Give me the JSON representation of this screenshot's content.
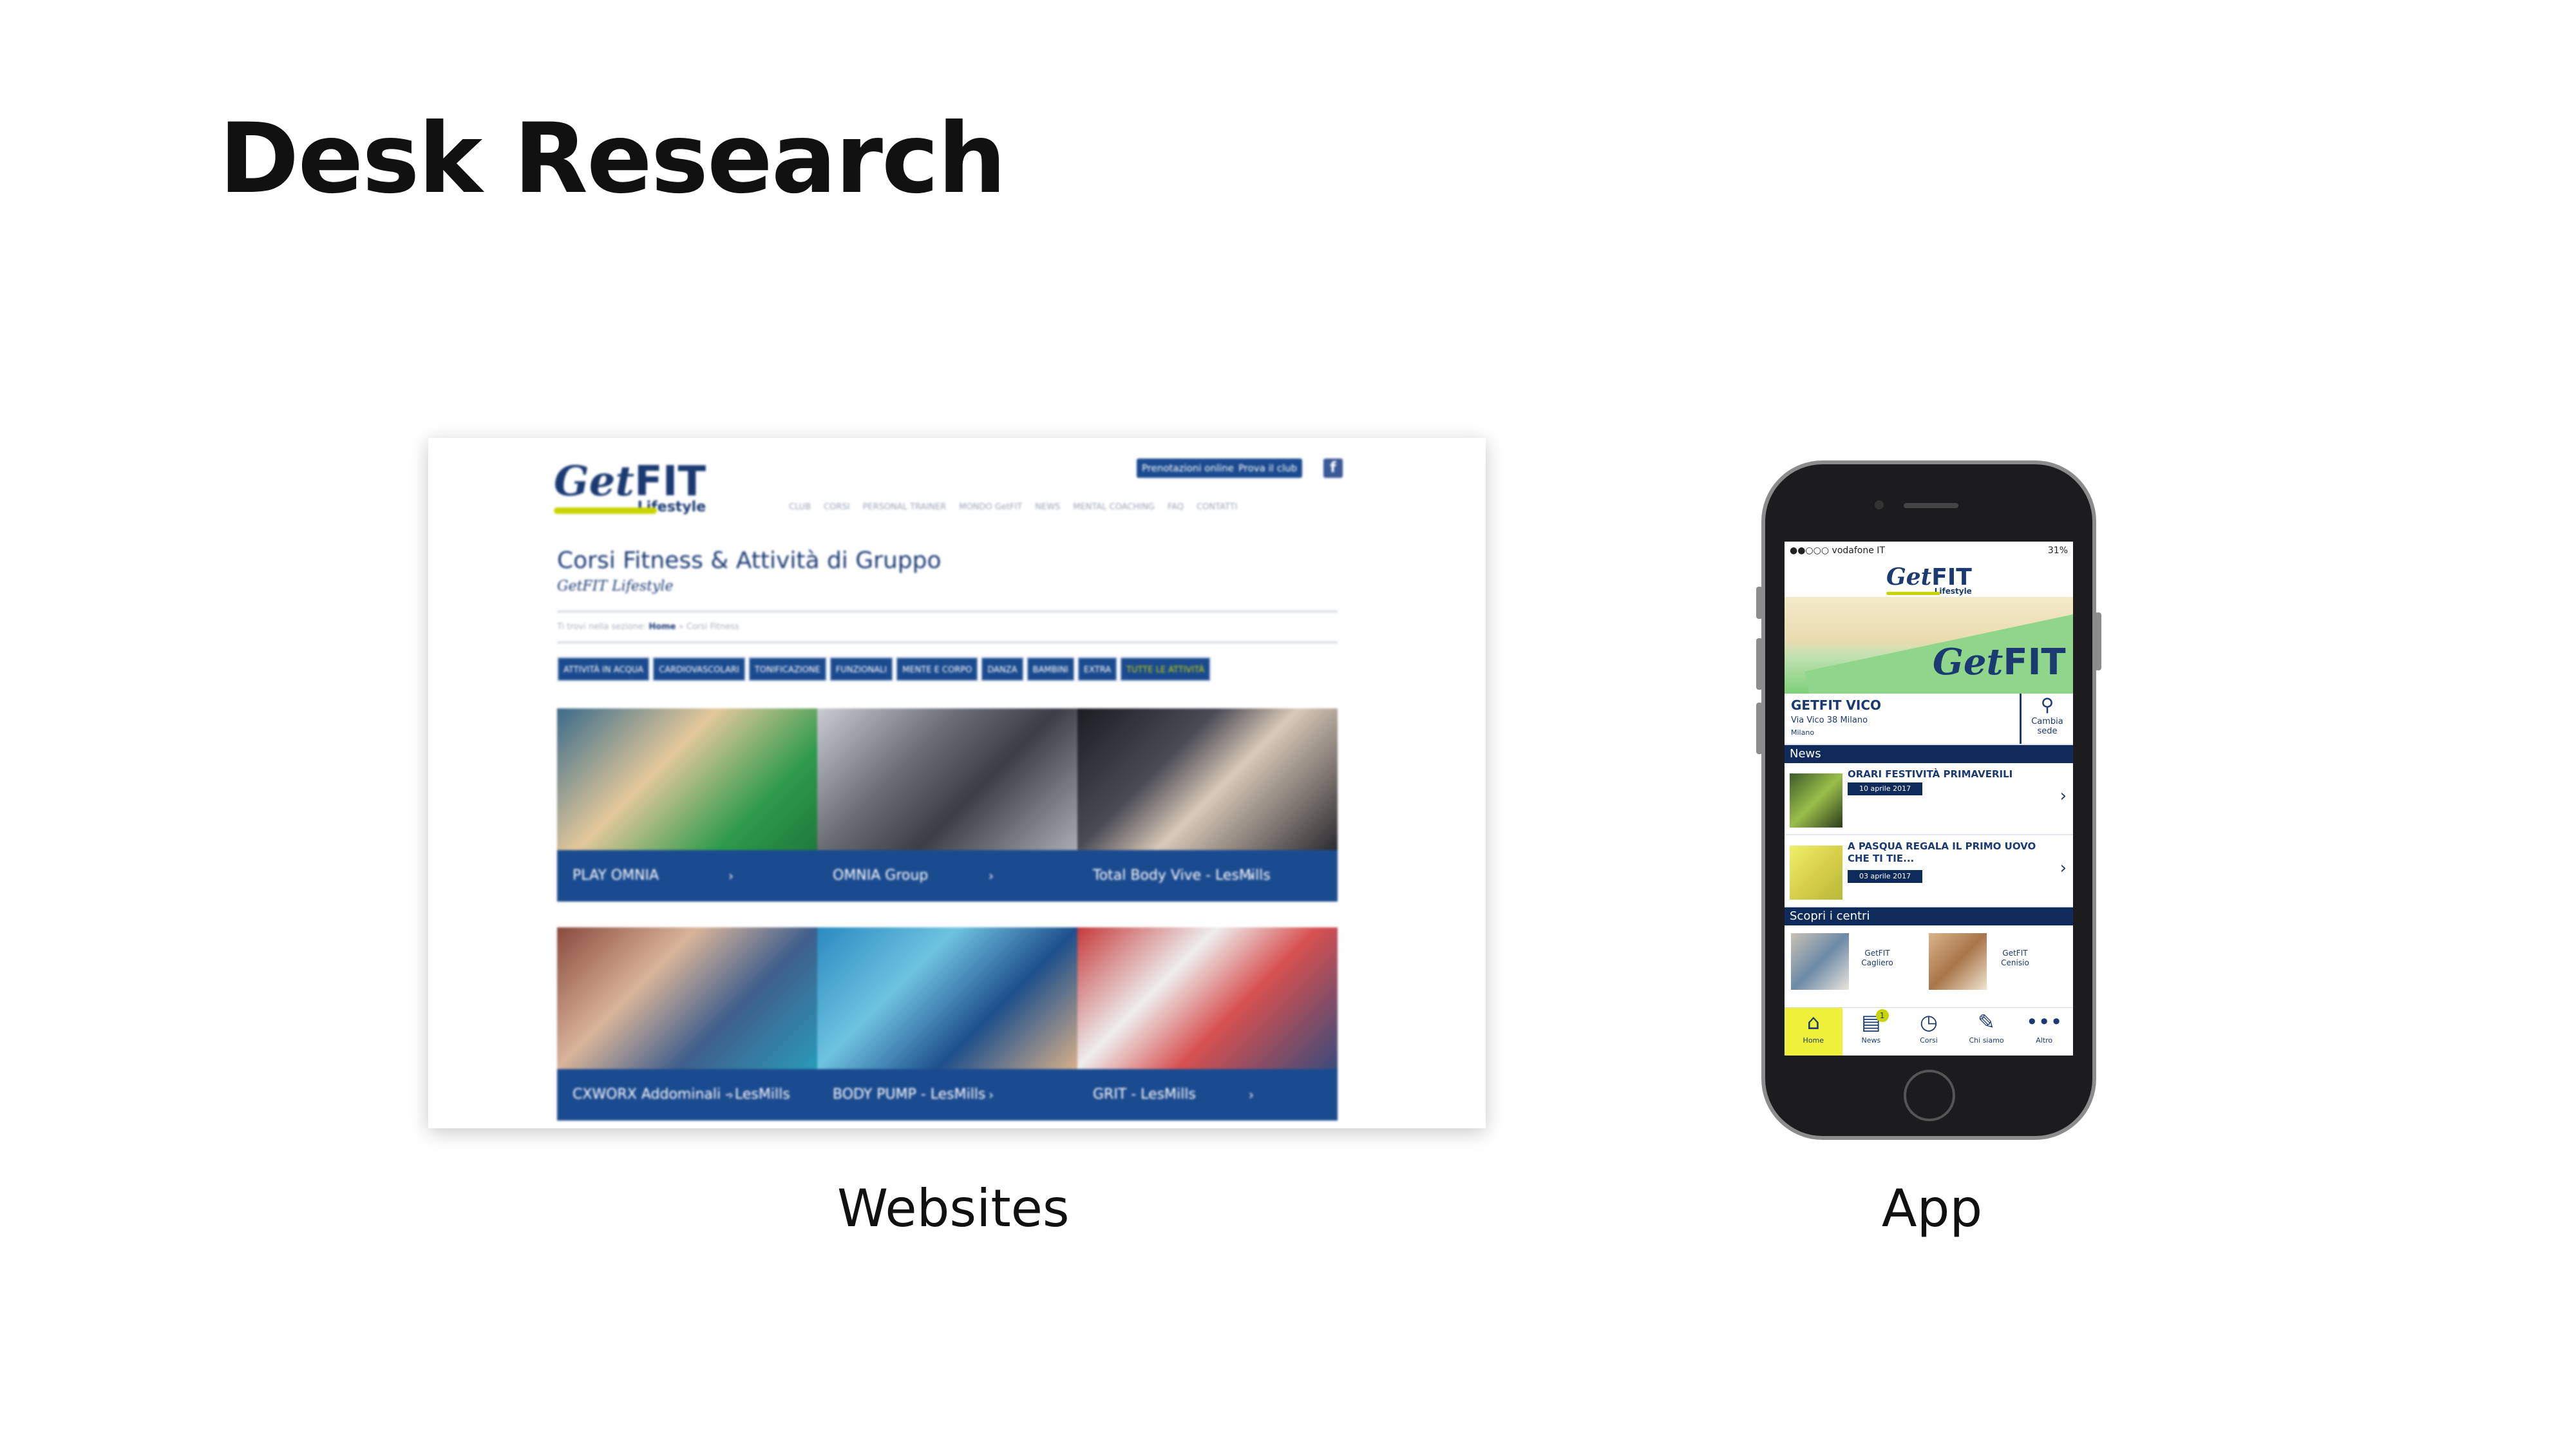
{
  "slide": {
    "title": "Desk Research"
  },
  "captions": {
    "websites": "Websites",
    "app": "App"
  },
  "website": {
    "logo": {
      "get": "Get",
      "fit": "FIT",
      "lifestyle": "Lifestyle"
    },
    "top_buttons": [
      "Prenotazioni online",
      "Prova il club"
    ],
    "facebook_glyph": "f",
    "nav": [
      "CLUB",
      "CORSI",
      "PERSONAL TRAINER",
      "MONDO GetFIT",
      "NEWS",
      "MENTAL COACHING",
      "FAQ",
      "CONTATTI"
    ],
    "heading": "Corsi Fitness & Attività di Gruppo",
    "subheading": "GetFIT Lifestyle",
    "breadcrumb": {
      "prefix": "Ti trovi nella sezione:",
      "home": "Home",
      "sep": "»",
      "current": "Corsi Fitness"
    },
    "categories": [
      "ATTIVITÀ IN ACQUA",
      "CARDIOVASCOLARI",
      "TONIFICAZIONE",
      "FUNZIONALI",
      "MENTE E CORPO",
      "DANZA",
      "BAMBINI",
      "EXTRA",
      "TUTTE LE ATTIVITÀ"
    ],
    "courses_row1": [
      "PLAY OMNIA",
      "OMNIA Group",
      "Total Body Vive - LesMills"
    ],
    "courses_row2": [
      "CXWORX Addominali - LesMills",
      "BODY PUMP - LesMills",
      "GRIT - LesMills"
    ],
    "chevron": "›",
    "colors": {
      "primary": "#1b4b8f",
      "accent": "#c8d400"
    }
  },
  "app": {
    "status": {
      "carrier": "●●○○○ vodafone IT",
      "battery": "31%"
    },
    "logo": {
      "get": "Get",
      "fit": "FIT",
      "lifestyle": "Lifestyle"
    },
    "club": {
      "name": "GETFIT VICO",
      "address": "Via Vico 38 Milano",
      "city": "Milano",
      "change_label": "Cambia sede"
    },
    "news_title": "News",
    "news": [
      {
        "title": "ORARI FESTIVITÀ PRIMAVERILI",
        "date": "10 aprile 2017"
      },
      {
        "title": "A PASQUA REGALA IL PRIMO UOVO CHE TI TIE...",
        "date": "03 aprile 2017"
      }
    ],
    "centri_title": "Scopri i centri",
    "centri": [
      "GetFIT Cagliero",
      "GetFIT Cenisio"
    ],
    "tabs": [
      {
        "label": "Home",
        "icon": "home-icon",
        "glyph": "⌂"
      },
      {
        "label": "News",
        "icon": "news-icon",
        "glyph": "▤",
        "badge": "1"
      },
      {
        "label": "Corsi",
        "icon": "clock-icon",
        "glyph": "◷"
      },
      {
        "label": "Chi siamo",
        "icon": "edit-icon",
        "glyph": "✎"
      },
      {
        "label": "Altro",
        "icon": "more-icon",
        "glyph": "•••"
      }
    ],
    "colors": {
      "navy": "#0e2b5c",
      "yellow": "#eef03a"
    }
  }
}
